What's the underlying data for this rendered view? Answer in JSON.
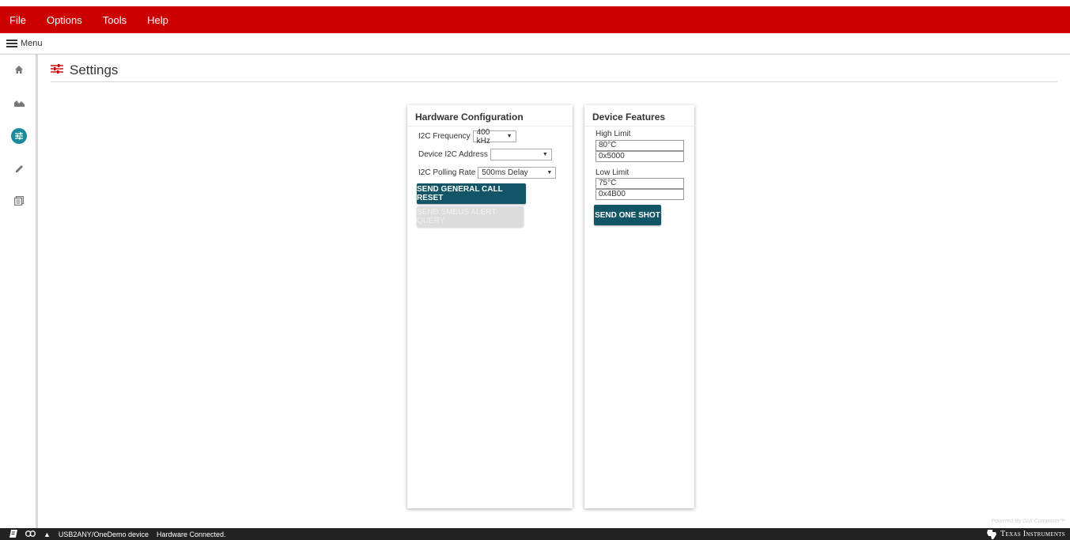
{
  "menubar": {
    "items": [
      "File",
      "Options",
      "Tools",
      "Help"
    ]
  },
  "nav": {
    "menu_label": "Menu"
  },
  "sidebar": {
    "items": [
      {
        "name": "home-icon"
      },
      {
        "name": "chart-icon"
      },
      {
        "name": "settings-icon",
        "active": true
      },
      {
        "name": "pencil-icon"
      },
      {
        "name": "register-icon"
      }
    ],
    "active_color": "#1a8a9c"
  },
  "page": {
    "title": "Settings"
  },
  "hardware": {
    "title": "Hardware Configuration",
    "freq_label": "I2C Frequency",
    "freq_value": "400 kHz",
    "addr_label": "Device I2C Address",
    "addr_value": "",
    "poll_label": "I2C Polling Rate",
    "poll_value": "500ms Delay",
    "reset_button": "SEND GENERAL CALL RESET",
    "alert_button": "SEND SMBUS ALERT QUERY"
  },
  "features": {
    "title": "Device Features",
    "high_label": "High Limit",
    "high_temp": "80°C",
    "high_hex": "0x5000",
    "low_label": "Low Limit",
    "low_temp": "75°C",
    "low_hex": "0x4B00",
    "oneshot_button": "SEND ONE SHOT"
  },
  "status": {
    "device": "USB2ANY/OneDemo device",
    "message": "Hardware Connected.",
    "brand": "Texas Instruments",
    "powered_by": "Powered By GUI Composer™"
  },
  "colors": {
    "brand_red": "#cc0000",
    "button": "#115566",
    "status_bg": "#222222"
  }
}
